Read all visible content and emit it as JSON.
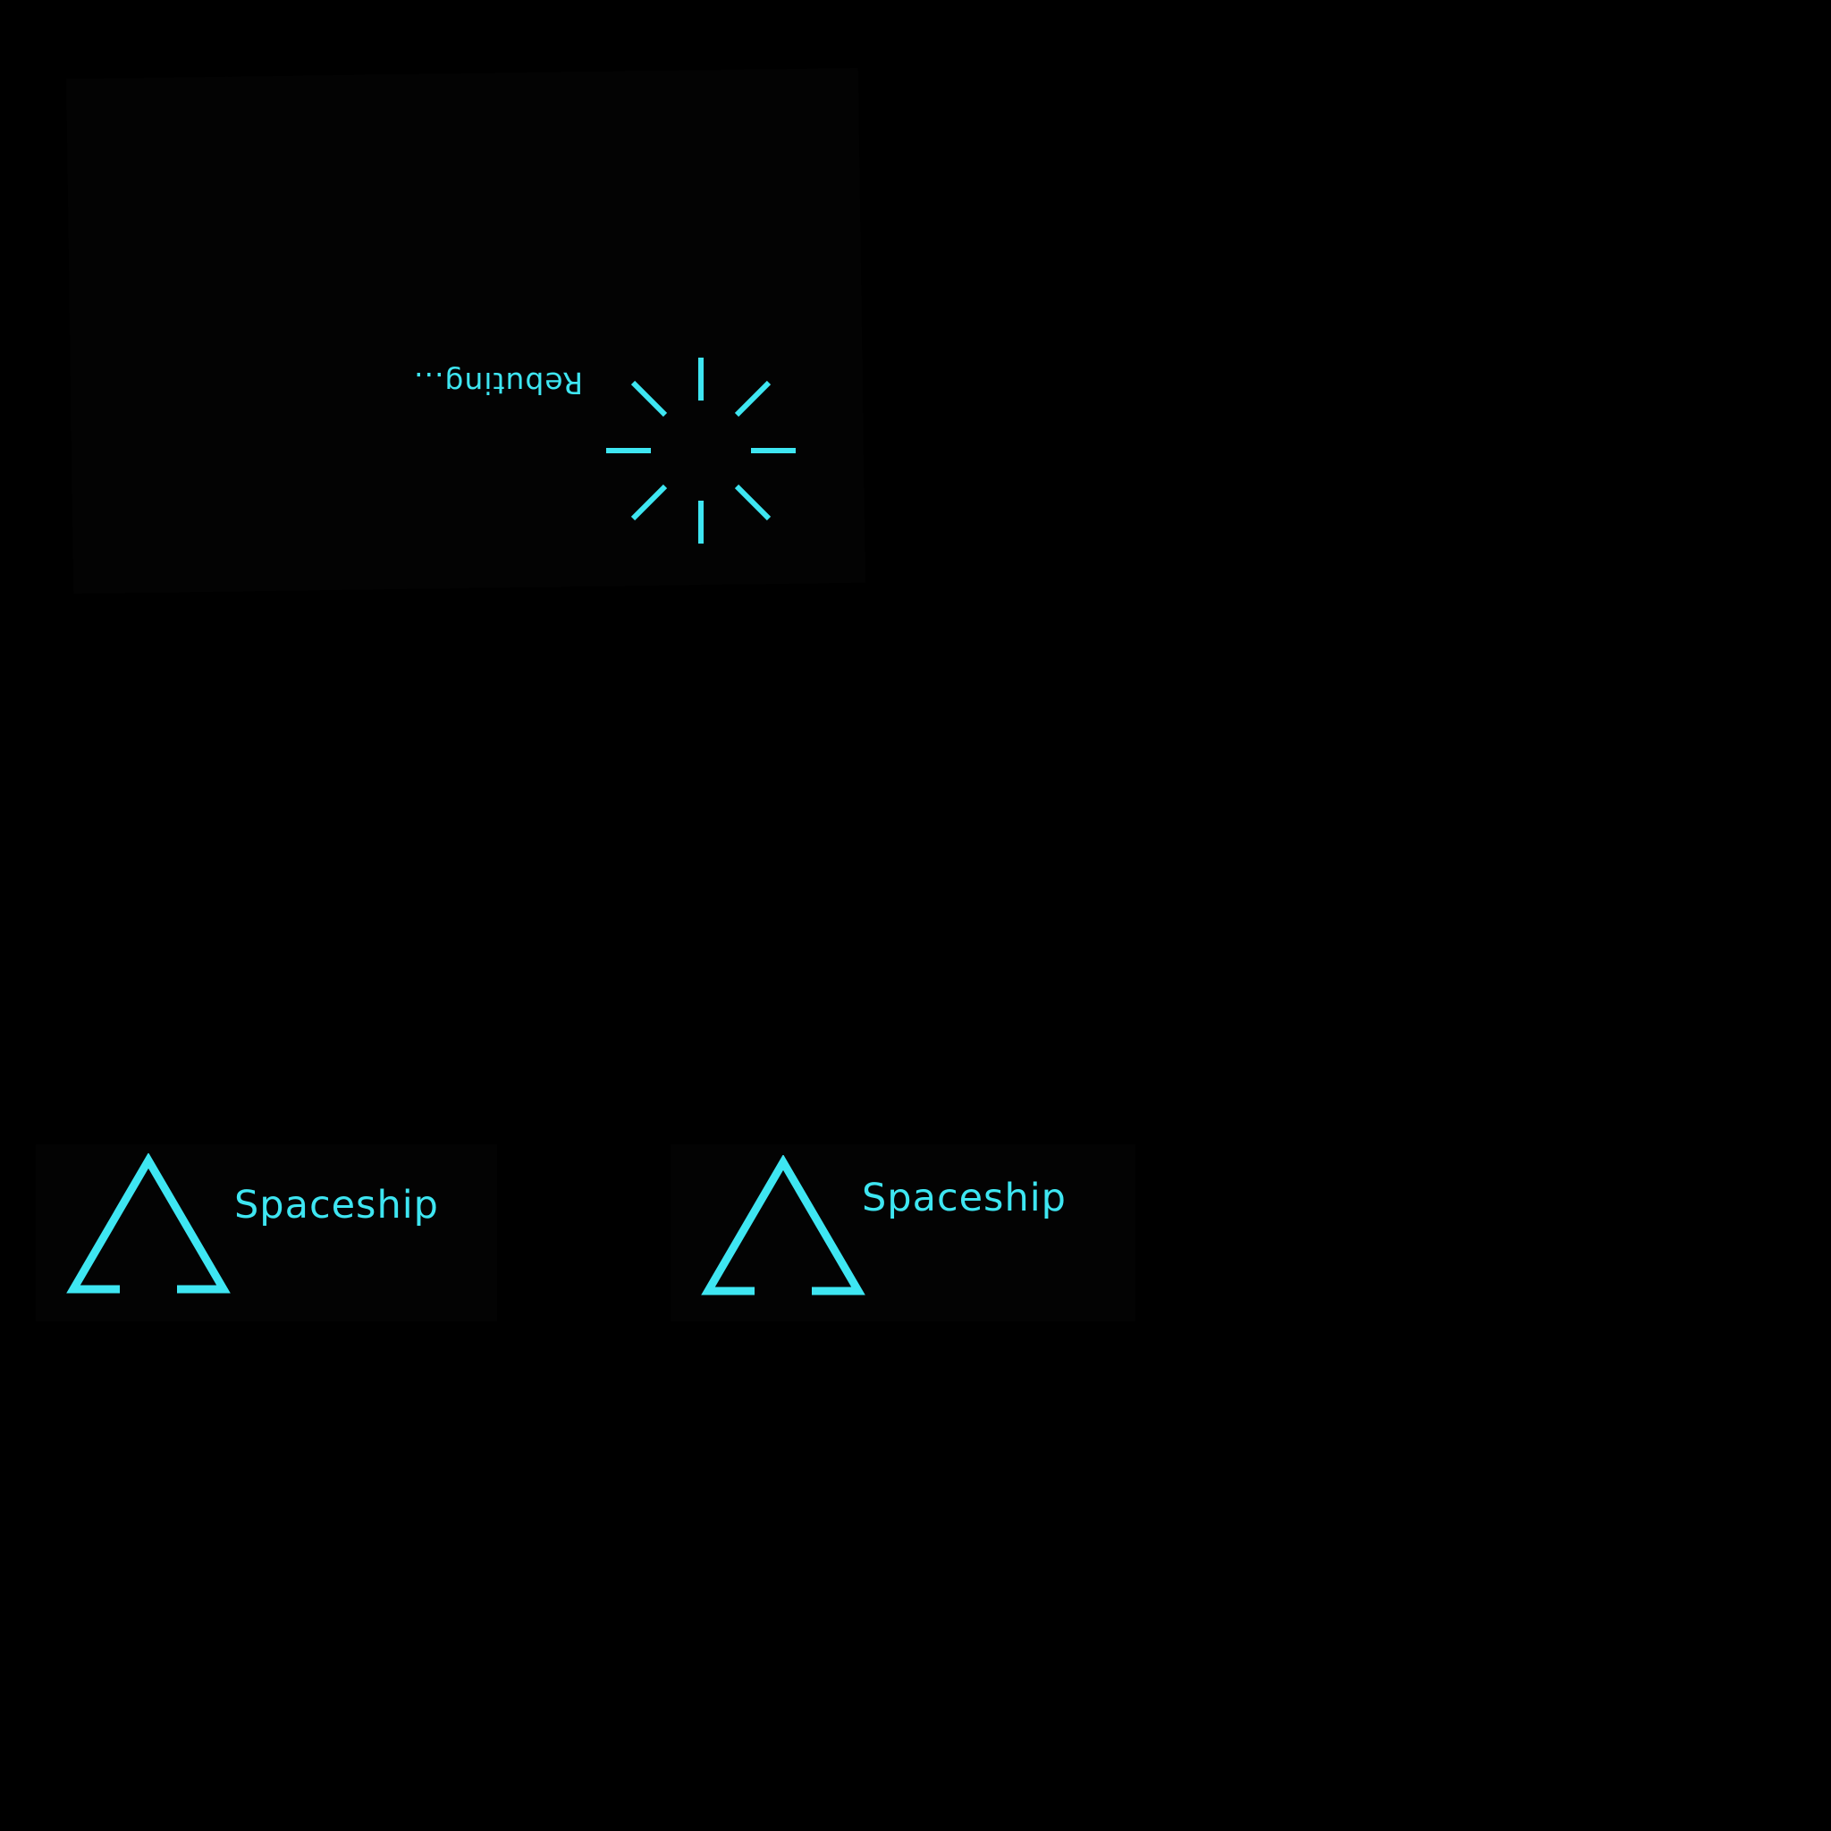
{
  "loader": {
    "status_text": "Rebuting...",
    "spinner_icon": "loading-spinner-icon"
  },
  "logos": [
    {
      "name": "Spaceship",
      "icon": "triangle-arrow-logo-icon"
    },
    {
      "name": "Spaceship",
      "icon": "triangle-arrow-logo-icon"
    }
  ],
  "colors": {
    "accent": "#3ee6f2",
    "background": "#000000",
    "panel": "#030303"
  }
}
